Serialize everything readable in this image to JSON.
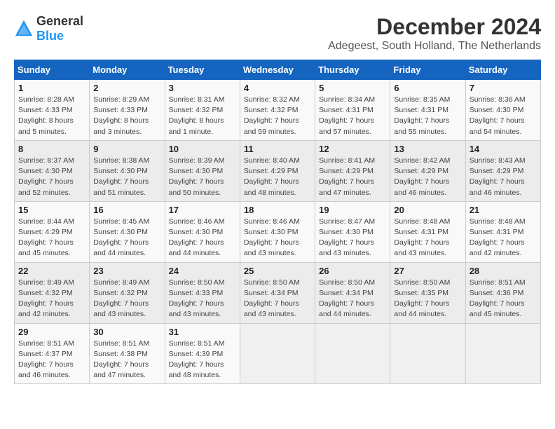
{
  "header": {
    "logo": {
      "text_general": "General",
      "text_blue": "Blue"
    },
    "title": "December 2024",
    "subtitle": "Adegeest, South Holland, The Netherlands"
  },
  "calendar": {
    "days_of_week": [
      "Sunday",
      "Monday",
      "Tuesday",
      "Wednesday",
      "Thursday",
      "Friday",
      "Saturday"
    ],
    "weeks": [
      [
        {
          "day": "1",
          "info": "Sunrise: 8:28 AM\nSunset: 4:33 PM\nDaylight: 8 hours\nand 5 minutes."
        },
        {
          "day": "2",
          "info": "Sunrise: 8:29 AM\nSunset: 4:33 PM\nDaylight: 8 hours\nand 3 minutes."
        },
        {
          "day": "3",
          "info": "Sunrise: 8:31 AM\nSunset: 4:32 PM\nDaylight: 8 hours\nand 1 minute."
        },
        {
          "day": "4",
          "info": "Sunrise: 8:32 AM\nSunset: 4:32 PM\nDaylight: 7 hours\nand 59 minutes."
        },
        {
          "day": "5",
          "info": "Sunrise: 8:34 AM\nSunset: 4:31 PM\nDaylight: 7 hours\nand 57 minutes."
        },
        {
          "day": "6",
          "info": "Sunrise: 8:35 AM\nSunset: 4:31 PM\nDaylight: 7 hours\nand 55 minutes."
        },
        {
          "day": "7",
          "info": "Sunrise: 8:36 AM\nSunset: 4:30 PM\nDaylight: 7 hours\nand 54 minutes."
        }
      ],
      [
        {
          "day": "8",
          "info": "Sunrise: 8:37 AM\nSunset: 4:30 PM\nDaylight: 7 hours\nand 52 minutes."
        },
        {
          "day": "9",
          "info": "Sunrise: 8:38 AM\nSunset: 4:30 PM\nDaylight: 7 hours\nand 51 minutes."
        },
        {
          "day": "10",
          "info": "Sunrise: 8:39 AM\nSunset: 4:30 PM\nDaylight: 7 hours\nand 50 minutes."
        },
        {
          "day": "11",
          "info": "Sunrise: 8:40 AM\nSunset: 4:29 PM\nDaylight: 7 hours\nand 48 minutes."
        },
        {
          "day": "12",
          "info": "Sunrise: 8:41 AM\nSunset: 4:29 PM\nDaylight: 7 hours\nand 47 minutes."
        },
        {
          "day": "13",
          "info": "Sunrise: 8:42 AM\nSunset: 4:29 PM\nDaylight: 7 hours\nand 46 minutes."
        },
        {
          "day": "14",
          "info": "Sunrise: 8:43 AM\nSunset: 4:29 PM\nDaylight: 7 hours\nand 46 minutes."
        }
      ],
      [
        {
          "day": "15",
          "info": "Sunrise: 8:44 AM\nSunset: 4:29 PM\nDaylight: 7 hours\nand 45 minutes."
        },
        {
          "day": "16",
          "info": "Sunrise: 8:45 AM\nSunset: 4:30 PM\nDaylight: 7 hours\nand 44 minutes."
        },
        {
          "day": "17",
          "info": "Sunrise: 8:46 AM\nSunset: 4:30 PM\nDaylight: 7 hours\nand 44 minutes."
        },
        {
          "day": "18",
          "info": "Sunrise: 8:46 AM\nSunset: 4:30 PM\nDaylight: 7 hours\nand 43 minutes."
        },
        {
          "day": "19",
          "info": "Sunrise: 8:47 AM\nSunset: 4:30 PM\nDaylight: 7 hours\nand 43 minutes."
        },
        {
          "day": "20",
          "info": "Sunrise: 8:48 AM\nSunset: 4:31 PM\nDaylight: 7 hours\nand 43 minutes."
        },
        {
          "day": "21",
          "info": "Sunrise: 8:48 AM\nSunset: 4:31 PM\nDaylight: 7 hours\nand 42 minutes."
        }
      ],
      [
        {
          "day": "22",
          "info": "Sunrise: 8:49 AM\nSunset: 4:32 PM\nDaylight: 7 hours\nand 42 minutes."
        },
        {
          "day": "23",
          "info": "Sunrise: 8:49 AM\nSunset: 4:32 PM\nDaylight: 7 hours\nand 43 minutes."
        },
        {
          "day": "24",
          "info": "Sunrise: 8:50 AM\nSunset: 4:33 PM\nDaylight: 7 hours\nand 43 minutes."
        },
        {
          "day": "25",
          "info": "Sunrise: 8:50 AM\nSunset: 4:34 PM\nDaylight: 7 hours\nand 43 minutes."
        },
        {
          "day": "26",
          "info": "Sunrise: 8:50 AM\nSunset: 4:34 PM\nDaylight: 7 hours\nand 44 minutes."
        },
        {
          "day": "27",
          "info": "Sunrise: 8:50 AM\nSunset: 4:35 PM\nDaylight: 7 hours\nand 44 minutes."
        },
        {
          "day": "28",
          "info": "Sunrise: 8:51 AM\nSunset: 4:36 PM\nDaylight: 7 hours\nand 45 minutes."
        }
      ],
      [
        {
          "day": "29",
          "info": "Sunrise: 8:51 AM\nSunset: 4:37 PM\nDaylight: 7 hours\nand 46 minutes."
        },
        {
          "day": "30",
          "info": "Sunrise: 8:51 AM\nSunset: 4:38 PM\nDaylight: 7 hours\nand 47 minutes."
        },
        {
          "day": "31",
          "info": "Sunrise: 8:51 AM\nSunset: 4:39 PM\nDaylight: 7 hours\nand 48 minutes."
        },
        {
          "day": "",
          "info": ""
        },
        {
          "day": "",
          "info": ""
        },
        {
          "day": "",
          "info": ""
        },
        {
          "day": "",
          "info": ""
        }
      ]
    ]
  }
}
